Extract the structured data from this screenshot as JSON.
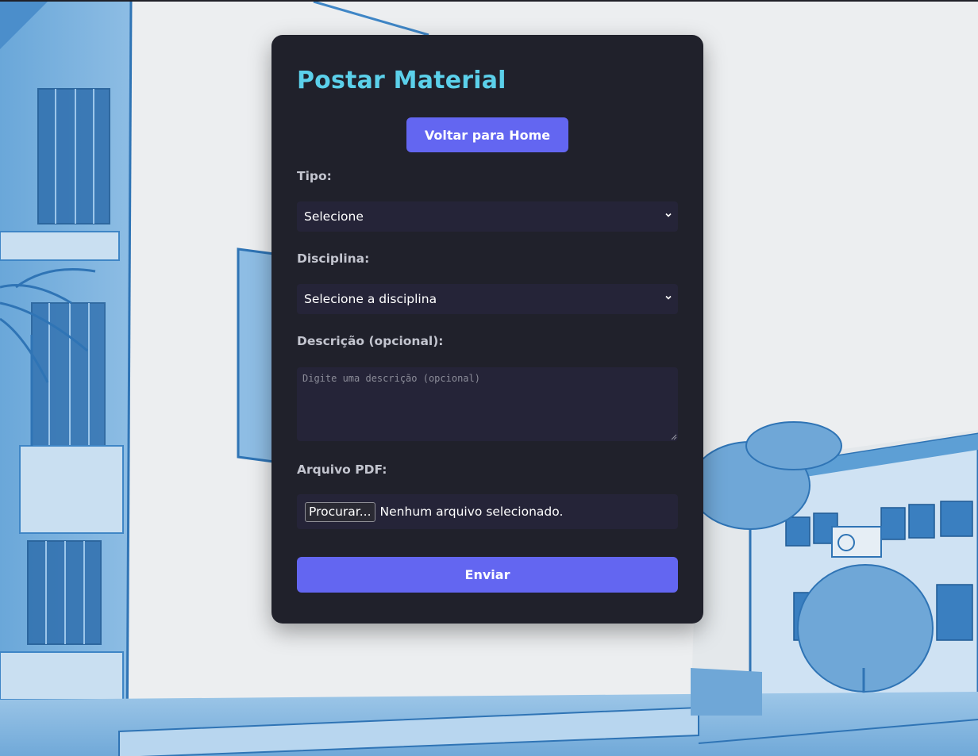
{
  "form": {
    "title": "Postar Material",
    "home_button": "Voltar para Home",
    "tipo": {
      "label": "Tipo:",
      "selected": "Selecione"
    },
    "disciplina": {
      "label": "Disciplina:",
      "selected": "Selecione a disciplina"
    },
    "descricao": {
      "label": "Descrição (opcional):",
      "placeholder": "Digite uma descrição (opcional)",
      "value": ""
    },
    "arquivo": {
      "label": "Arquivo PDF:",
      "browse_button": "Procurar...",
      "status": "Nenhum arquivo selecionado."
    },
    "submit_button": "Enviar"
  },
  "colors": {
    "accent": "#6366f1",
    "title": "#5bd0ea",
    "card_bg": "#20212b",
    "field_bg": "#252438",
    "label": "#c3c5cf",
    "background_sketch": "#3f86c6"
  },
  "icons": {
    "select_arrow": "chevron-down-icon",
    "textarea_resize": "resize-grip-icon"
  }
}
